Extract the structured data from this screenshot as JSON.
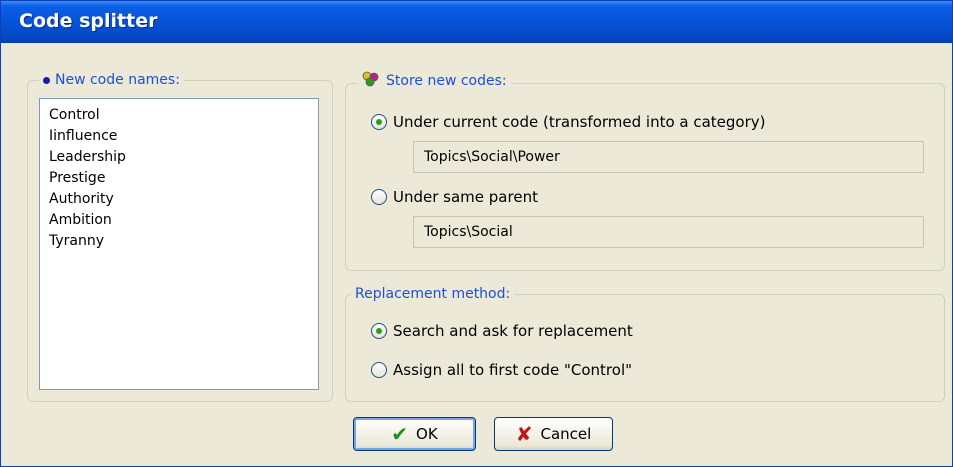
{
  "window": {
    "title": "Code splitter"
  },
  "new_codes": {
    "legend": "New code names:",
    "items": [
      "Control",
      "Iinfluence",
      "Leadership",
      "Prestige",
      "Authority",
      "Ambition",
      "Tyranny"
    ]
  },
  "store": {
    "legend": "Store new codes:",
    "option_current": "Under current code (transformed into a category)",
    "current_path": "Topics\\Social\\Power",
    "option_parent": "Under same parent",
    "parent_path": "Topics\\Social",
    "selected": "current"
  },
  "replacement": {
    "legend": "Replacement method:",
    "option_search": "Search and ask for replacement",
    "option_assign": "Assign all to first code \"Control\"",
    "selected": "search"
  },
  "buttons": {
    "ok": "OK",
    "cancel": "Cancel"
  }
}
